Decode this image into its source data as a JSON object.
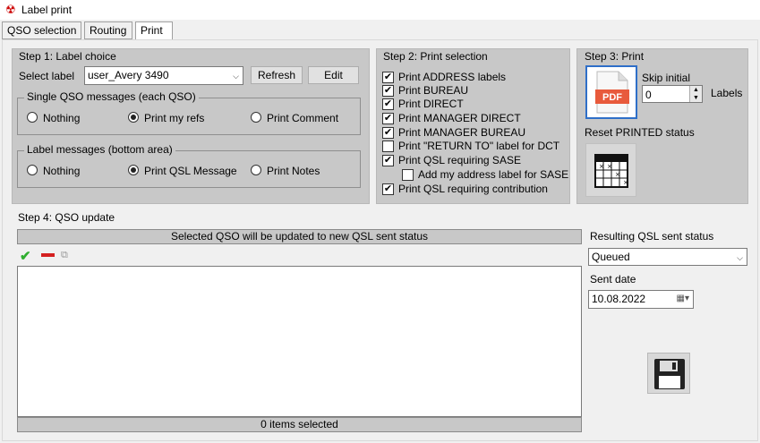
{
  "window": {
    "title": "Label print"
  },
  "tabs": [
    {
      "label": "QSO selection"
    },
    {
      "label": "Routing"
    },
    {
      "label": "Print"
    }
  ],
  "step1": {
    "title": "Step 1: Label choice",
    "select_label": "Select label",
    "label_value": "user_Avery 3490",
    "refresh": "Refresh",
    "edit": "Edit",
    "single_group": {
      "title": "Single QSO messages (each QSO)",
      "options": [
        "Nothing",
        "Print my refs",
        "Print Comment"
      ],
      "selected": "Print my refs"
    },
    "label_group": {
      "title": "Label messages (bottom area)",
      "options": [
        "Nothing",
        "Print QSL Message",
        "Print Notes"
      ],
      "selected": "Print QSL Message"
    }
  },
  "step2": {
    "title": "Step 2: Print selection",
    "items": [
      {
        "label": "Print ADDRESS labels",
        "checked": true
      },
      {
        "label": "Print BUREAU",
        "checked": true
      },
      {
        "label": "Print DIRECT",
        "checked": true
      },
      {
        "label": "Print MANAGER DIRECT",
        "checked": true
      },
      {
        "label": "Print MANAGER BUREAU",
        "checked": true
      },
      {
        "label": "Print \"RETURN TO\" label for DCT",
        "checked": false
      },
      {
        "label": "Print QSL requiring SASE",
        "checked": true
      },
      {
        "label": "Add my address label for SASE",
        "checked": false
      },
      {
        "label": "Print QSL requiring contribution",
        "checked": true
      }
    ]
  },
  "step3": {
    "title": "Step 3: Print",
    "pdf_text": "PDF",
    "skip_initial": "Skip initial",
    "skip_value": "0",
    "labels": "Labels",
    "reset_status": "Reset PRINTED status"
  },
  "step4": {
    "title": "Step 4: QSO update",
    "banner": "Selected QSO will be updated to new QSL sent status",
    "footer": "0 items selected",
    "result_label": "Resulting QSL sent status",
    "result_value": "Queued",
    "sent_date_label": "Sent date",
    "sent_date_value": "10.08.2022"
  },
  "colors": {
    "panel": "#c8c8c8",
    "pdf_red": "#e85a3c",
    "pdf_frame": "#2f6fc8",
    "check_green": "#2fae2f",
    "minus_red": "#d42020"
  }
}
